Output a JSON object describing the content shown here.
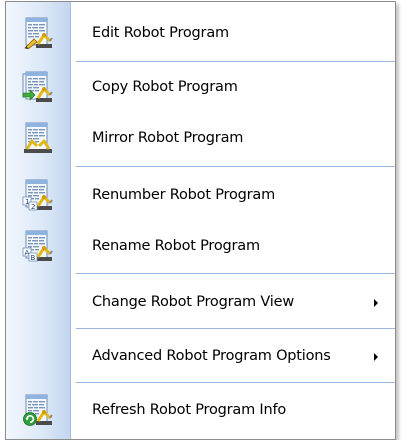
{
  "menu": {
    "items": [
      {
        "label": "Edit Robot Program",
        "icon": "edit-robot-program-icon"
      },
      {
        "label": "Copy Robot Program",
        "icon": "copy-robot-program-icon"
      },
      {
        "label": "Mirror Robot Program",
        "icon": "mirror-robot-program-icon"
      },
      {
        "label": "Renumber Robot Program",
        "icon": "renumber-robot-program-icon"
      },
      {
        "label": "Rename Robot Program",
        "icon": "rename-robot-program-icon"
      },
      {
        "label": "Change Robot Program View",
        "submenu": true
      },
      {
        "label": "Advanced Robot Program Options",
        "submenu": true
      },
      {
        "label": "Refresh Robot Program Info",
        "icon": "refresh-robot-program-info-icon"
      }
    ]
  },
  "colors": {
    "gutter_light": "#f2f7fd",
    "gutter_dark": "#c3d6ef",
    "separator": "#9db6dc",
    "text": "#000000"
  }
}
